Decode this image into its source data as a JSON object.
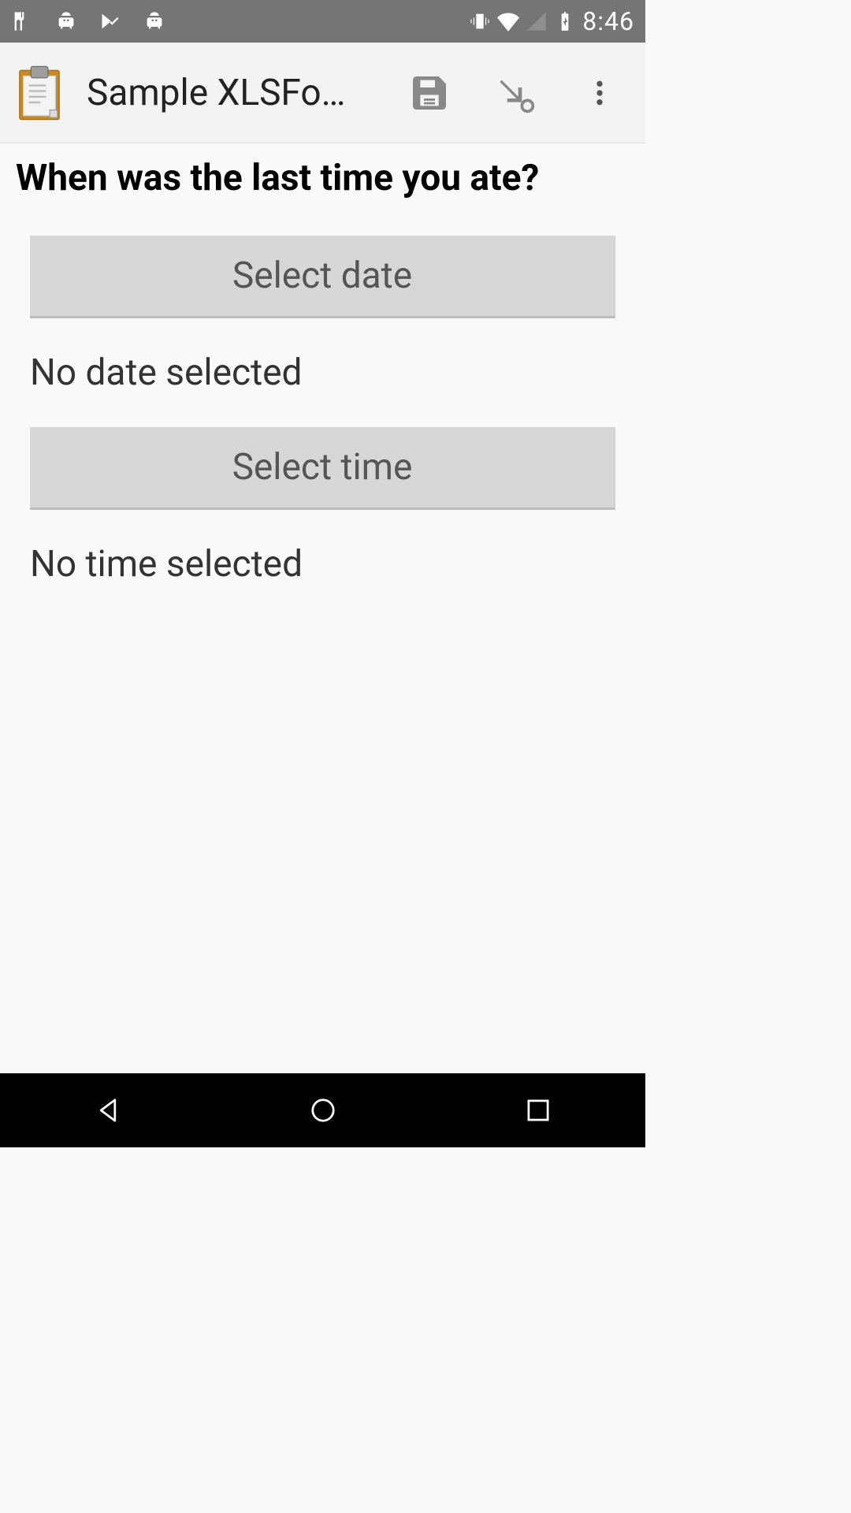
{
  "status": {
    "time": "8:46"
  },
  "appbar": {
    "title": "Sample XLSFo…"
  },
  "question": "When was the last time you ate?",
  "date": {
    "button_label": "Select date",
    "value_label": "No date selected"
  },
  "time": {
    "button_label": "Select time",
    "value_label": "No time selected"
  }
}
